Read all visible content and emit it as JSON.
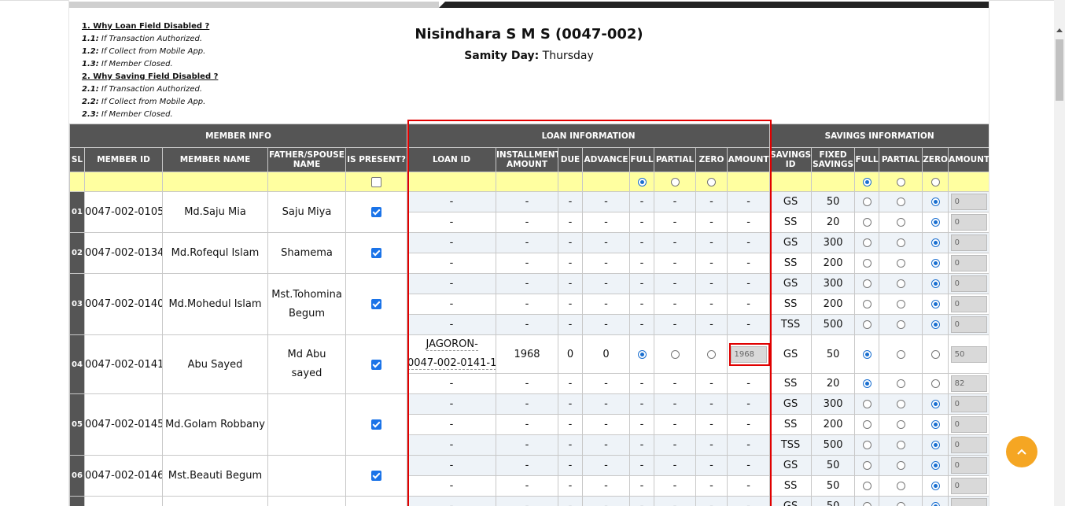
{
  "notes": [
    {
      "type": "head",
      "text": "1. Why Loan Field Disabled ?"
    },
    {
      "type": "item",
      "key": "1.1:",
      "text": "If Transaction Authorized."
    },
    {
      "type": "item",
      "key": "1.2:",
      "text": "If Collect from Mobile App."
    },
    {
      "type": "item",
      "key": "1.3:",
      "text": "If Member Closed."
    },
    {
      "type": "head",
      "text": "2. Why Saving Field Disabled ?"
    },
    {
      "type": "item",
      "key": "2.1:",
      "text": "If Transaction Authorized."
    },
    {
      "type": "item",
      "key": "2.2:",
      "text": "If Collect from Mobile App."
    },
    {
      "type": "item",
      "key": "2.3:",
      "text": "If Member Closed."
    }
  ],
  "header": {
    "title": "Nisindhara S M S (0047-002)",
    "samity_label": "Samity Day:",
    "samity_value": "Thursday"
  },
  "groups": {
    "member": "MEMBER INFO",
    "loan": "LOAN INFORMATION",
    "savings": "SAVINGS INFORMATION"
  },
  "columns": {
    "sl": "SL",
    "member_id": "MEMBER ID",
    "member_name": "MEMBER NAME",
    "father": "FATHER/SPOUSE NAME",
    "present": "IS PRESENT?",
    "loan_id": "LOAN ID",
    "installment": "INSTALLMENT AMOUNT",
    "due": "DUE",
    "advance": "ADVANCE",
    "full": "FULL",
    "partial": "PARTIAL",
    "zero": "ZERO",
    "amount": "AMOUNT",
    "savings_id": "SAVINGS ID",
    "fixed": "FIXED SAVINGS"
  },
  "colors": {
    "header_bg": "#555555",
    "yellow_row": "#ffffa0",
    "highlight": "#e00000",
    "fab": "#f5a623",
    "radio_on": "#1a6fd0"
  },
  "members": [
    {
      "sl": "01",
      "id": "0047-002-0105",
      "name": "Md.Saju Mia",
      "father": "Saju Miya",
      "present": true,
      "rows": [
        {
          "loan": null,
          "sid": "GS",
          "fixed": "50",
          "sel": "zero",
          "amount": "0"
        },
        {
          "loan": null,
          "sid": "SS",
          "fixed": "20",
          "sel": "zero",
          "amount": "0"
        }
      ]
    },
    {
      "sl": "02",
      "id": "0047-002-0134",
      "name": "Md.Rofequl Islam",
      "father": "Shamema",
      "present": true,
      "rows": [
        {
          "loan": null,
          "sid": "GS",
          "fixed": "300",
          "sel": "zero",
          "amount": "0"
        },
        {
          "loan": null,
          "sid": "SS",
          "fixed": "200",
          "sel": "zero",
          "amount": "0"
        }
      ]
    },
    {
      "sl": "03",
      "id": "0047-002-0140",
      "name": "Md.Mohedul Islam",
      "father": "Mst.Tohomina Begum",
      "present": true,
      "rows": [
        {
          "loan": null,
          "sid": "GS",
          "fixed": "300",
          "sel": "zero",
          "amount": "0"
        },
        {
          "loan": null,
          "sid": "SS",
          "fixed": "200",
          "sel": "zero",
          "amount": "0"
        },
        {
          "loan": null,
          "sid": "TSS",
          "fixed": "500",
          "sel": "zero",
          "amount": "0"
        }
      ]
    },
    {
      "sl": "04",
      "id": "0047-002-0141",
      "name": "Abu Sayed",
      "father": "Md Abu sayed",
      "present": true,
      "rows": [
        {
          "loan": {
            "id_line1": "JAGORON-",
            "id_line2": "0047-002-0141-1",
            "installment": "1968",
            "due": "0",
            "advance": "0",
            "sel": "full",
            "amount": "1968"
          },
          "sid": "GS",
          "fixed": "50",
          "sel": "full",
          "amount": "50"
        },
        {
          "loan": null,
          "sid": "SS",
          "fixed": "20",
          "sel": "full",
          "amount": "82"
        }
      ]
    },
    {
      "sl": "05",
      "id": "0047-002-0145",
      "name": "Md.Golam Robbany",
      "father": "",
      "present": true,
      "rows": [
        {
          "loan": null,
          "sid": "GS",
          "fixed": "300",
          "sel": "zero",
          "amount": "0"
        },
        {
          "loan": null,
          "sid": "SS",
          "fixed": "200",
          "sel": "zero",
          "amount": "0"
        },
        {
          "loan": null,
          "sid": "TSS",
          "fixed": "500",
          "sel": "zero",
          "amount": "0"
        }
      ]
    },
    {
      "sl": "06",
      "id": "0047-002-0146",
      "name": "Mst.Beauti Begum",
      "father": "",
      "present": true,
      "rows": [
        {
          "loan": null,
          "sid": "GS",
          "fixed": "50",
          "sel": "zero",
          "amount": "0"
        },
        {
          "loan": null,
          "sid": "SS",
          "fixed": "50",
          "sel": "zero",
          "amount": "0"
        }
      ]
    },
    {
      "sl": "",
      "id": "",
      "name": "",
      "father": "",
      "present": false,
      "rows": [
        {
          "loan": null,
          "sid": "GS",
          "fixed": "50",
          "sel": "zero",
          "amount": ""
        }
      ]
    }
  ],
  "dash": "-",
  "fab_icon": "chevron-up-icon"
}
